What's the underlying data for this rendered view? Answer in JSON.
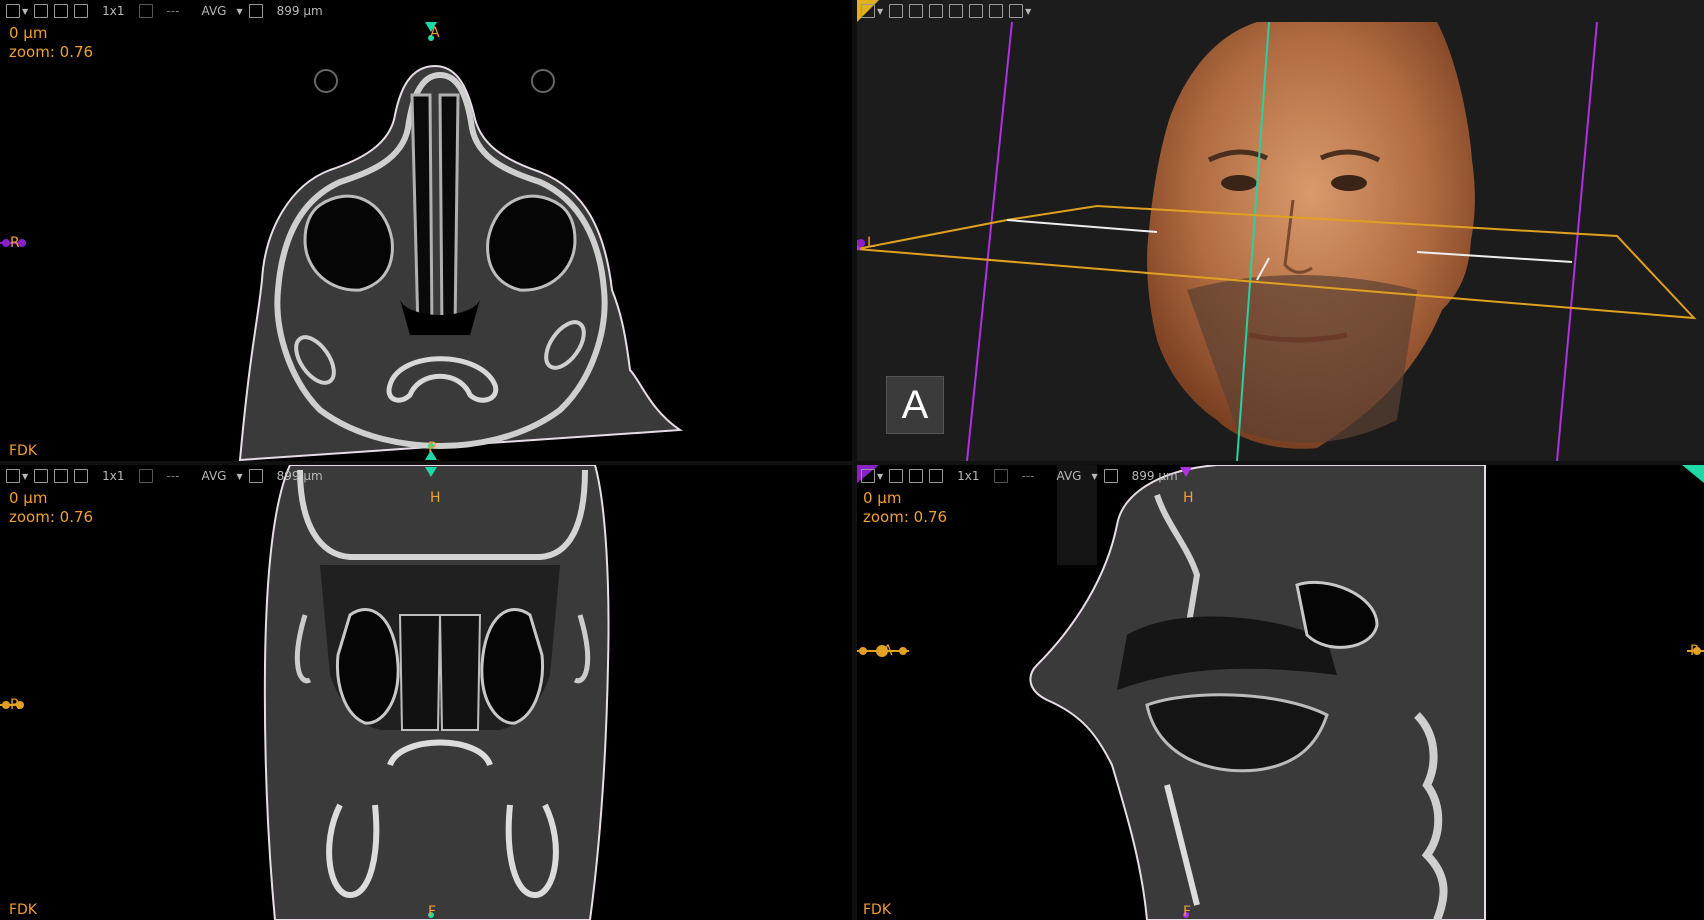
{
  "toolbar": {
    "layout": "1x1",
    "dashes": "---",
    "projection": "AVG",
    "thickness": "899 µm"
  },
  "viewports": {
    "axial": {
      "slice": "0 µm",
      "zoom": "zoom: 0.76",
      "recon": "FDK",
      "top": "A",
      "bottom": "P",
      "left": "R"
    },
    "coronal": {
      "slice": "0 µm",
      "zoom": "zoom: 0.76",
      "recon": "FDK",
      "top": "H",
      "bottom": "F",
      "left": "R"
    },
    "sagittal": {
      "slice": "0 µm",
      "zoom": "zoom: 0.76",
      "recon": "FDK",
      "top": "H",
      "bottom": "F",
      "left": "A",
      "right": "P"
    },
    "three_d": {
      "left": "L",
      "cube_label": "A"
    }
  },
  "colors": {
    "overlay_text": "#f0a030",
    "axial_marker": "#8a20c8",
    "coronal_marker": "#e0a020",
    "sagittal_marker": "#1ed8a8"
  },
  "icons": [
    "save-icon",
    "fit-icon",
    "snapshot-icon",
    "layout-icon",
    "sync-icon",
    "copy-icon",
    "cube-view-icon"
  ]
}
